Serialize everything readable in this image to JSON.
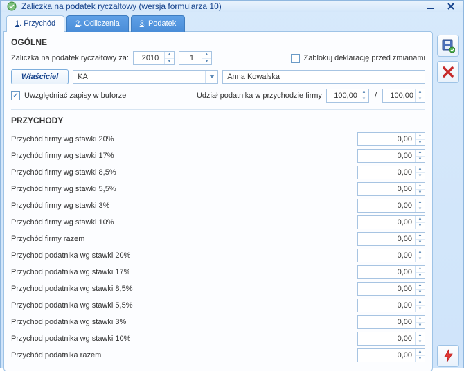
{
  "window": {
    "title": "Zaliczka na podatek ryczałtowy (wersja formularza 10)"
  },
  "tabs": [
    {
      "num": "1",
      "label": "Przychód",
      "active": true
    },
    {
      "num": "2",
      "label": "Odliczenia",
      "active": false
    },
    {
      "num": "3",
      "label": "Podatek",
      "active": false
    }
  ],
  "general": {
    "title": "OGÓLNE",
    "period_label": "Zaliczka na podatek ryczałtowy za:",
    "year": "2010",
    "month": "1",
    "lock_label": "Zablokuj deklarację przed zmianami",
    "lock_checked": false,
    "owner_btn": "Właściciel",
    "owner_code": "KA",
    "owner_name": "Anna Kowalska",
    "buffer_label": "Uwzględniać zapisy w buforze",
    "buffer_checked": true,
    "share_label": "Udział podatnika w przychodzie firmy",
    "share_num": "100,00",
    "share_den": "100,00"
  },
  "revenue": {
    "title": "PRZYCHODY",
    "rows": [
      {
        "label": "Przychód firmy wg stawki 20%",
        "value": "0,00"
      },
      {
        "label": "Przychód firmy wg stawki 17%",
        "value": "0,00"
      },
      {
        "label": "Przychód firmy wg stawki 8,5%",
        "value": "0,00"
      },
      {
        "label": "Przychód firmy wg stawki 5,5%",
        "value": "0,00"
      },
      {
        "label": "Przychód firmy wg stawki 3%",
        "value": "0,00"
      },
      {
        "label": "Przychód firmy wg stawki 10%",
        "value": "0,00"
      },
      {
        "label": "Przychód firmy razem",
        "value": "0,00"
      },
      {
        "label": "Przychod podatnika wg stawki 20%",
        "value": "0,00"
      },
      {
        "label": "Przychod podatnika wg stawki 17%",
        "value": "0,00"
      },
      {
        "label": "Przychod podatnika wg stawki 8,5%",
        "value": "0,00"
      },
      {
        "label": "Przychod podatnika wg stawki 5,5%",
        "value": "0,00"
      },
      {
        "label": "Przychod podatnika wg stawki 3%",
        "value": "0,00"
      },
      {
        "label": "Przychod podatnika wg stawki 10%",
        "value": "0,00"
      },
      {
        "label": "Przychód podatnika razem",
        "value": "0,00"
      }
    ]
  }
}
